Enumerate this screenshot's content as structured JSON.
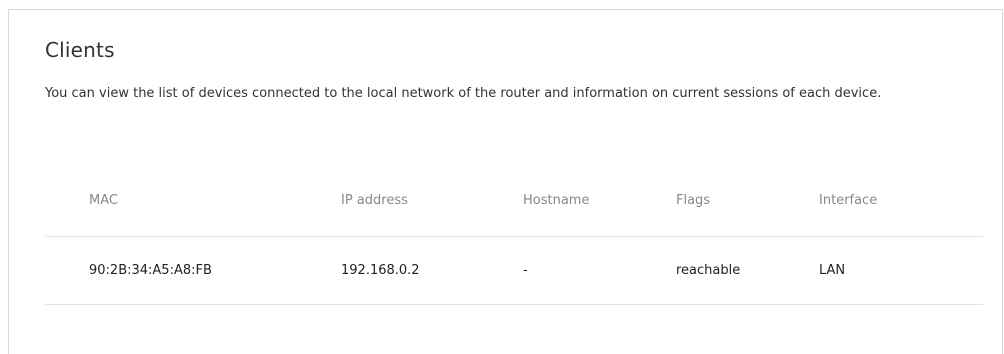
{
  "page": {
    "title": "Clients",
    "description": "You can view the list of devices connected to the local network of the router and information on current sessions of each device."
  },
  "table": {
    "columns": [
      "MAC",
      "IP address",
      "Hostname",
      "Flags",
      "Interface"
    ],
    "rows": [
      {
        "mac": "90:2B:34:A5:A8:FB",
        "ip": "192.168.0.2",
        "hostname": "-",
        "flags": "reachable",
        "interface": "LAN"
      }
    ]
  }
}
